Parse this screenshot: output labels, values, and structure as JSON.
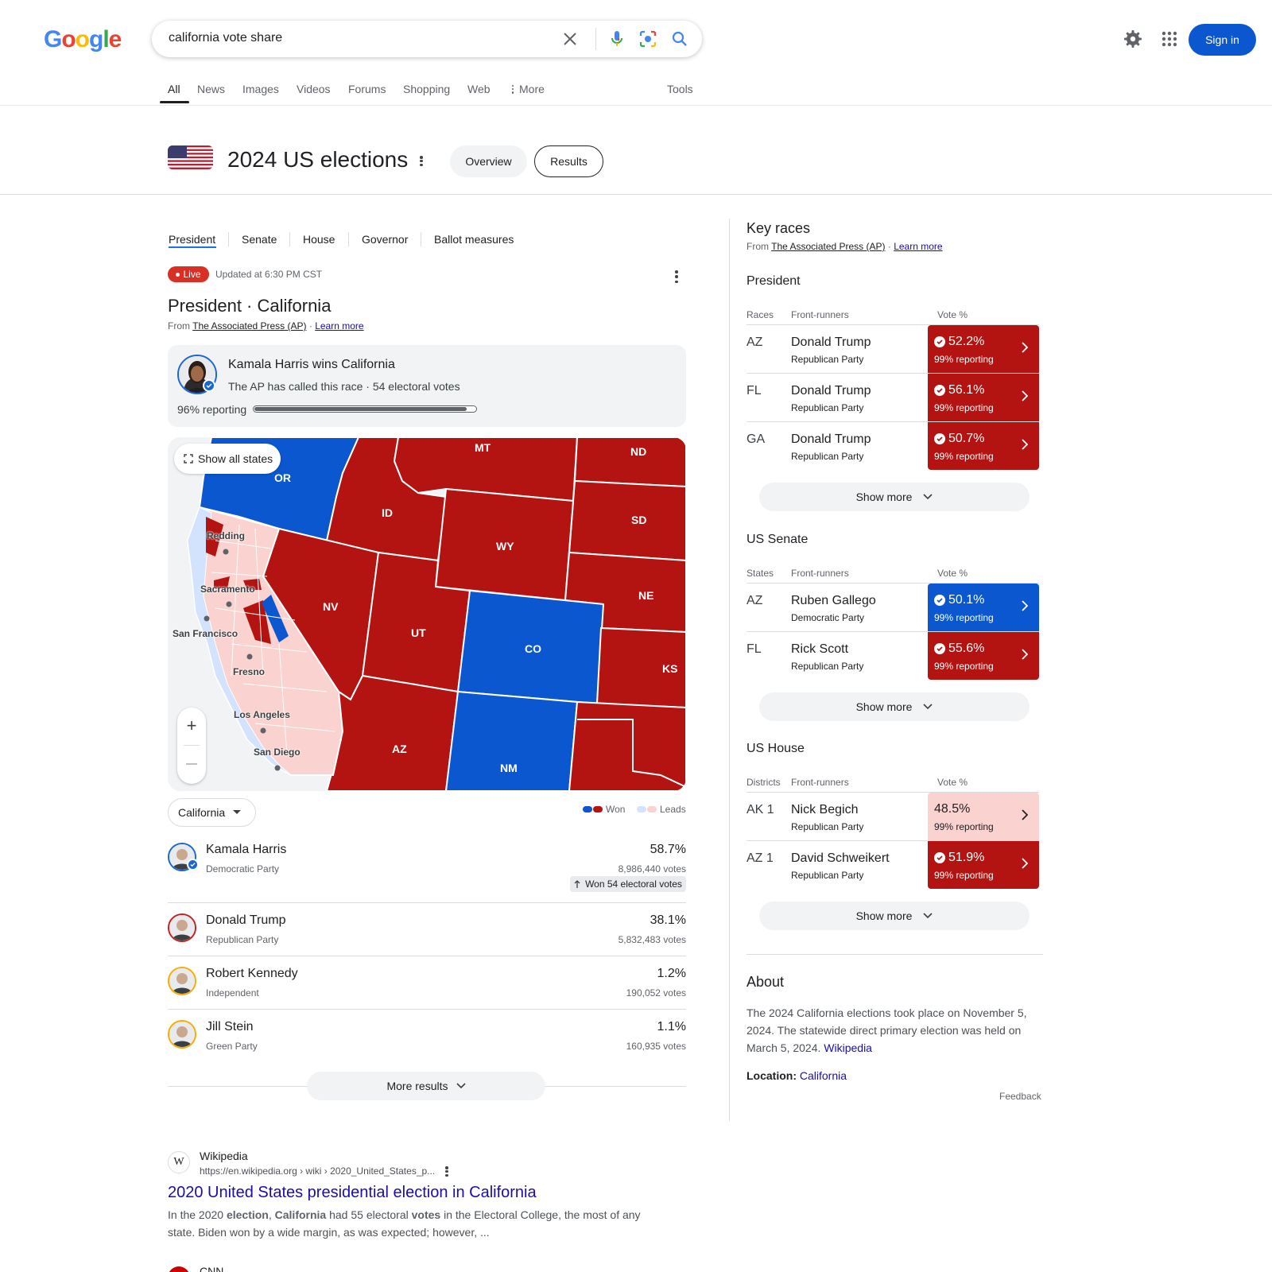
{
  "header": {
    "logo_letters": [
      "G",
      "o",
      "o",
      "g",
      "l",
      "e"
    ],
    "logo_colors": [
      "#4285F4",
      "#EA4335",
      "#FBBC05",
      "#4285F4",
      "#34A853",
      "#EA4335"
    ],
    "query": "california vote share",
    "sign_in": "Sign in"
  },
  "nav_tabs": [
    "All",
    "News",
    "Images",
    "Videos",
    "Forums",
    "Shopping",
    "Web",
    "More",
    "Tools"
  ],
  "election": {
    "title": "2024 US elections",
    "overview_label": "Overview",
    "results_label": "Results",
    "subtabs": [
      "President",
      "Senate",
      "House",
      "Governor",
      "Ballot measures"
    ],
    "live_label": "Live",
    "updated": "Updated at 6:30 PM CST",
    "race_title": "President · California",
    "from_prefix": "From",
    "source": "The Associated Press (AP)",
    "learn_more": "Learn more",
    "winner_heading": "Kamala Harris wins California",
    "winner_sub": "The AP has called this race · 54 electoral votes",
    "reporting_label": "96% reporting",
    "reporting_fraction": 0.96
  },
  "map": {
    "show_all": "Show all states",
    "state_labels": [
      "OR",
      "MT",
      "ND",
      "ID",
      "SD",
      "WY",
      "NV",
      "NE",
      "UT",
      "CO",
      "KS",
      "AZ",
      "NM"
    ],
    "city_labels": [
      "Redding",
      "Sacramento",
      "San Francisco",
      "Fresno",
      "Los Angeles",
      "San Diego"
    ],
    "colors": {
      "dem_won": "#0b57d0",
      "rep_won": "#b31412",
      "dem_leads": "#d3e3fd",
      "rep_leads": "#fad2cf"
    }
  },
  "state_selector": "California",
  "legend": {
    "won": "Won",
    "leads": "Leads"
  },
  "candidates": [
    {
      "name": "Kamala Harris",
      "party": "Democratic Party",
      "pct": "58.7%",
      "votes": "8,986,440 votes",
      "chip": "Won 54 electoral votes",
      "ring": "#1967d2"
    },
    {
      "name": "Donald Trump",
      "party": "Republican Party",
      "pct": "38.1%",
      "votes": "5,832,483 votes",
      "ring": "#c5221f"
    },
    {
      "name": "Robert Kennedy",
      "party": "Independent",
      "pct": "1.2%",
      "votes": "190,052 votes",
      "ring": "#f9ab00"
    },
    {
      "name": "Jill Stein",
      "party": "Green Party",
      "pct": "1.1%",
      "votes": "160,935 votes",
      "ring": "#f9ab00"
    }
  ],
  "more_results": "More results",
  "key_races": {
    "title": "Key races",
    "from_prefix": "From",
    "source": "The Associated Press (AP)",
    "learn_more": "Learn more",
    "show_more": "Show more",
    "vote_header": "Vote %",
    "frontrunners_header": "Front-runners",
    "sections": [
      {
        "title": "President",
        "first_header": "Races",
        "rows": [
          {
            "code": "AZ",
            "name": "Donald Trump",
            "party": "Republican Party",
            "pct": "52.2%",
            "reporting": "99% reporting",
            "status": "rep_won"
          },
          {
            "code": "FL",
            "name": "Donald Trump",
            "party": "Republican Party",
            "pct": "56.1%",
            "reporting": "99% reporting",
            "status": "rep_won"
          },
          {
            "code": "GA",
            "name": "Donald Trump",
            "party": "Republican Party",
            "pct": "50.7%",
            "reporting": "99% reporting",
            "status": "rep_won"
          }
        ]
      },
      {
        "title": "US Senate",
        "first_header": "States",
        "rows": [
          {
            "code": "AZ",
            "name": "Ruben Gallego",
            "party": "Democratic Party",
            "pct": "50.1%",
            "reporting": "99% reporting",
            "status": "dem_won"
          },
          {
            "code": "FL",
            "name": "Rick Scott",
            "party": "Republican Party",
            "pct": "55.6%",
            "reporting": "99% reporting",
            "status": "rep_won"
          }
        ]
      },
      {
        "title": "US House",
        "first_header": "Districts",
        "rows": [
          {
            "code": "AK 1",
            "name": "Nick Begich",
            "party": "Republican Party",
            "pct": "48.5%",
            "reporting": "99% reporting",
            "status": "rep_leads"
          },
          {
            "code": "AZ 1",
            "name": "David Schweikert",
            "party": "Republican Party",
            "pct": "51.9%",
            "reporting": "99% reporting",
            "status": "rep_won"
          }
        ]
      }
    ]
  },
  "about": {
    "title": "About",
    "text": "The 2024 California elections took place on November 5, 2024. The statewide direct primary election was held on March 5, 2024.",
    "wiki_link": "Wikipedia",
    "location_label": "Location:",
    "location_value": "California",
    "feedback": "Feedback"
  },
  "result": {
    "site": "Wikipedia",
    "favicon_letter": "W",
    "url": "https://en.wikipedia.org › wiki › 2020_United_States_p...",
    "title": "2020 United States presidential election in California",
    "snippet_parts": [
      {
        "t": "In the 2020 ",
        "b": false
      },
      {
        "t": "election",
        "b": true
      },
      {
        "t": ", ",
        "b": false
      },
      {
        "t": "California",
        "b": true
      },
      {
        "t": " had 55 electoral ",
        "b": false
      },
      {
        "t": "votes",
        "b": true
      },
      {
        "t": " in the Electoral College, the most of any state. Biden won by a wide margin, as was expected; however, ...",
        "b": false
      }
    ],
    "next_site": "CNN"
  }
}
